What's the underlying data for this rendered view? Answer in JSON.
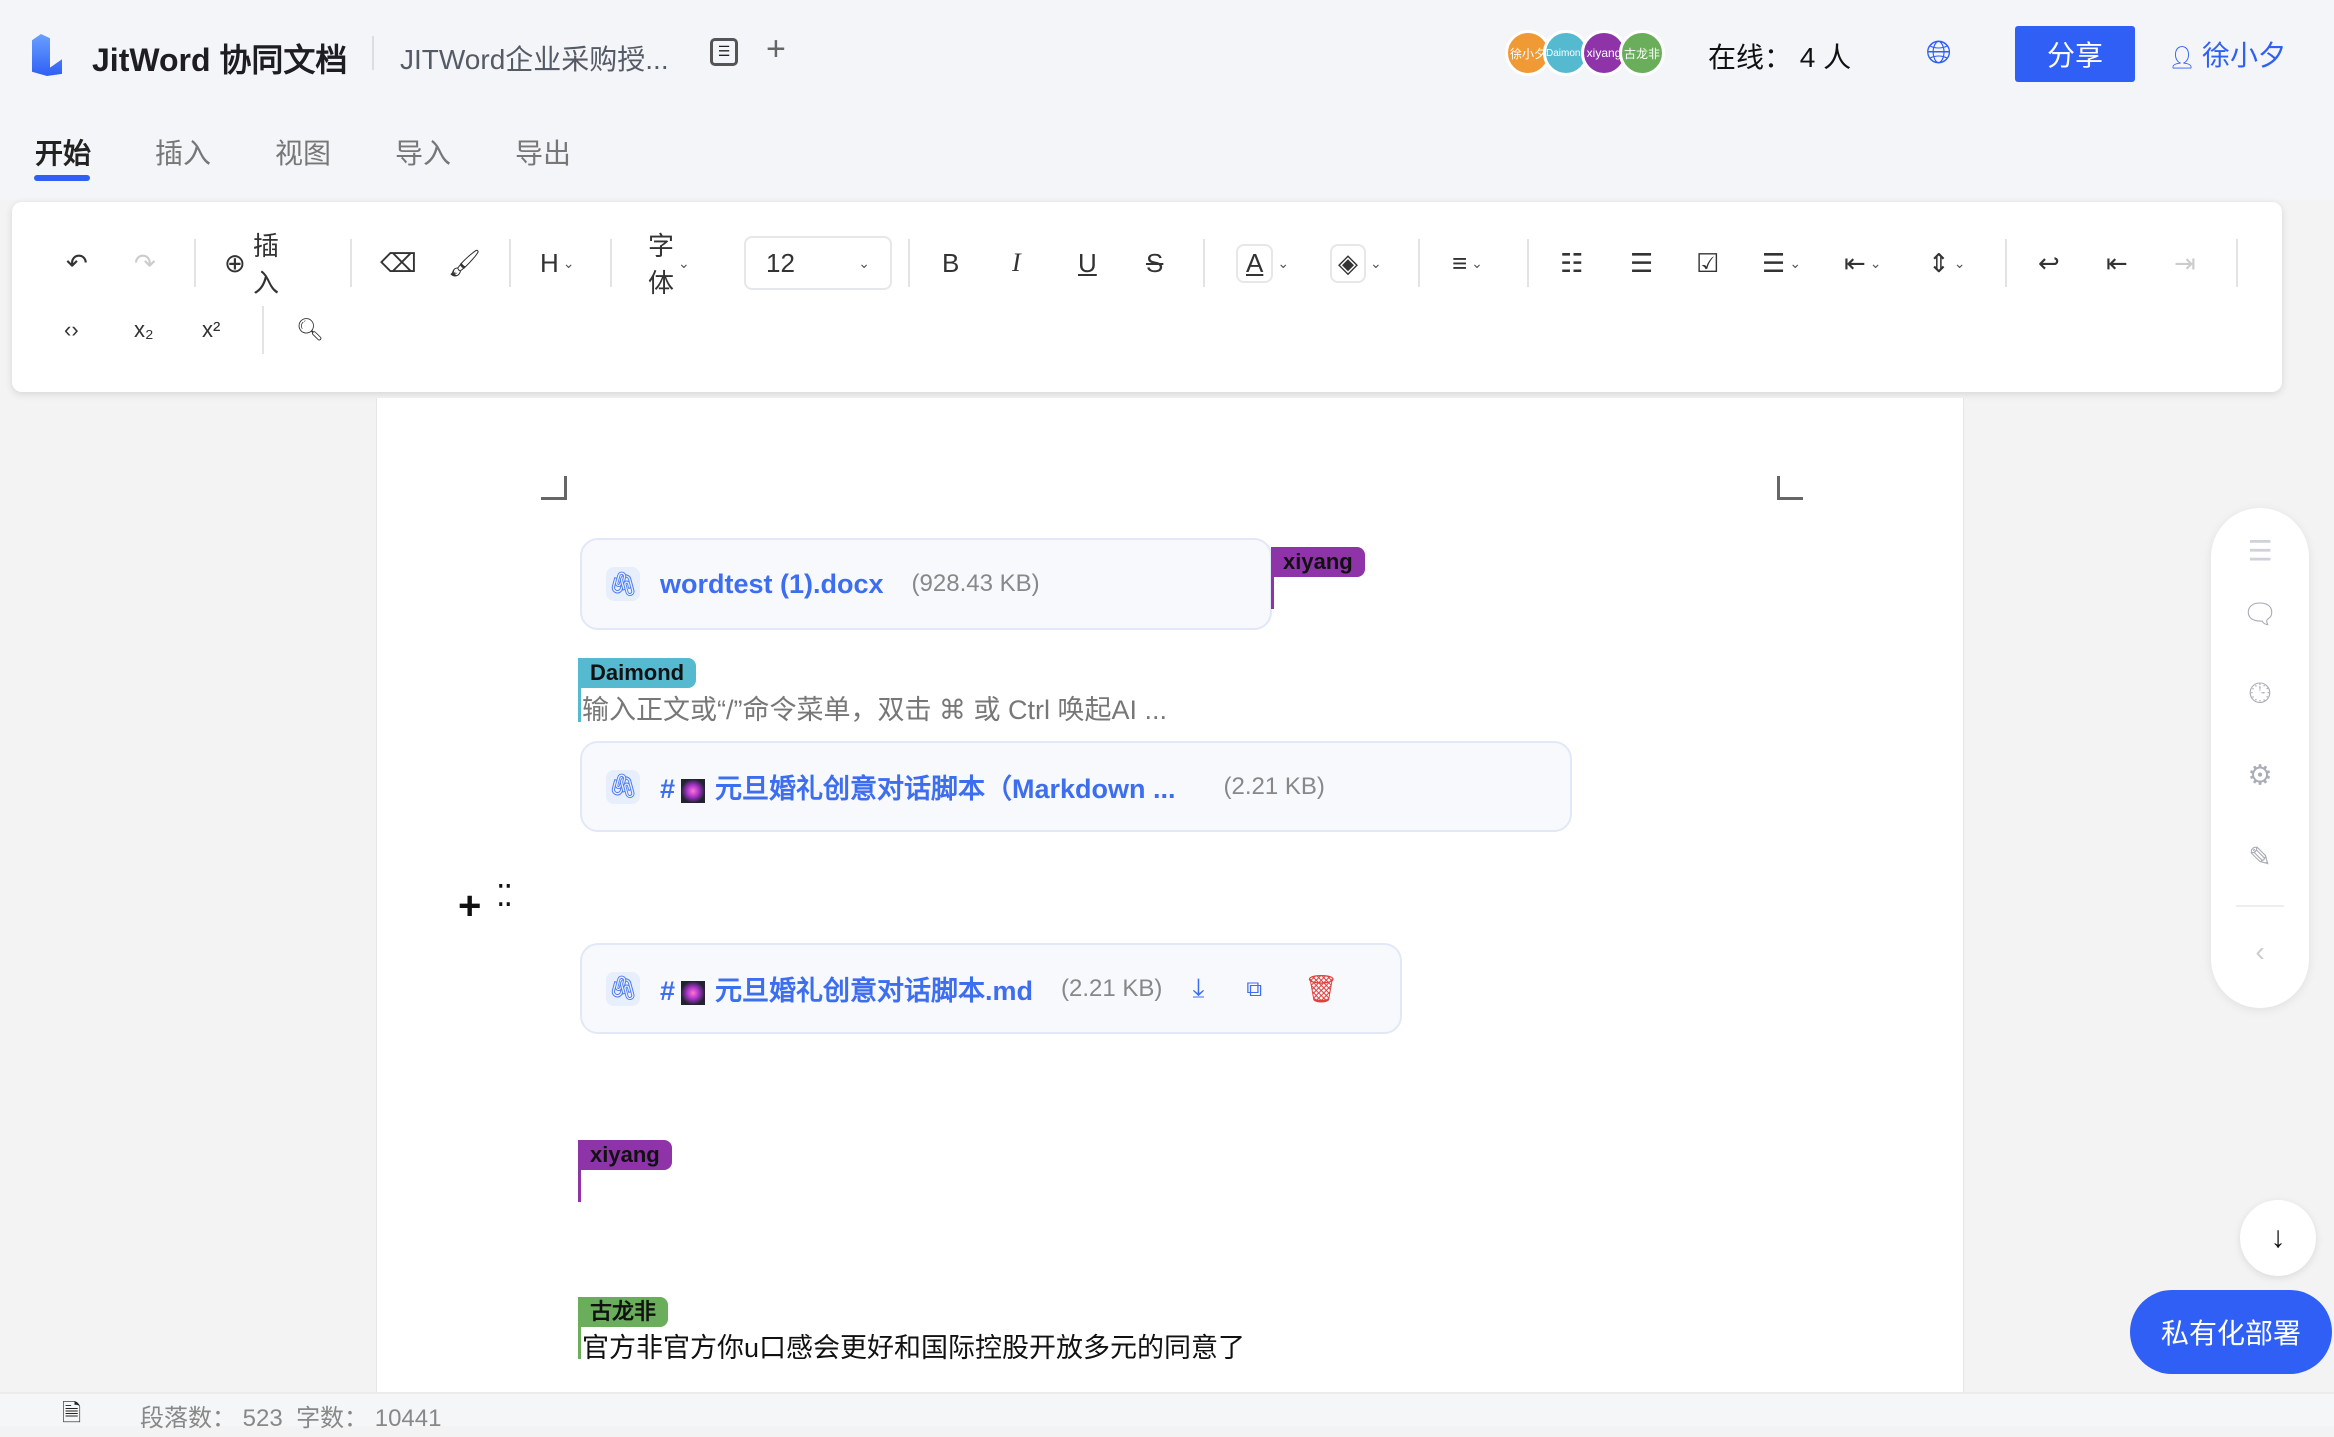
{
  "header": {
    "app_title": "JitWord 协同文档",
    "doc_title": "JITWord企业采购授...",
    "online_label": "在线：",
    "online_count": "4 人",
    "share_label": "分享",
    "user_name": "徐小夕",
    "avatars": [
      {
        "label": "徐小夕",
        "color": "#f09a35"
      },
      {
        "label": "Daimond",
        "color": "#55b9d0"
      },
      {
        "label": "xiyang",
        "color": "#8e33a8"
      },
      {
        "label": "古龙非",
        "color": "#6aad5b"
      }
    ]
  },
  "tabs": [
    "开始",
    "插入",
    "视图",
    "导入",
    "导出"
  ],
  "toolbar": {
    "insert_label": "插入",
    "heading_label": "H",
    "font_label": "字体",
    "font_size": "12",
    "subscript": "x₂",
    "superscript": "x²"
  },
  "doc": {
    "file1": {
      "name": "wordtest (1).docx",
      "size": "(928.43 KB)"
    },
    "file2": {
      "name": "元旦婚礼创意对话脚本（Markdown ...",
      "prefix": "#",
      "size": "(2.21 KB)"
    },
    "file3": {
      "name": "元旦婚礼创意对话脚本.md",
      "prefix": "#",
      "size": "(2.21 KB)"
    },
    "placeholder": "输入正文或“/”命令菜单，双击 ⌘ 或 Ctrl 唤起AI ...",
    "paragraph": "官方非官方你u口感会更好和国际控股开放多元的同意了",
    "cursors": [
      {
        "user": "xiyang",
        "color": "#8e33a8"
      },
      {
        "user": "Daimond",
        "color": "#55b9d0"
      },
      {
        "user": "xiyang",
        "color": "#8e33a8"
      },
      {
        "user": "古龙非",
        "color": "#6aad5b"
      }
    ]
  },
  "status": {
    "para_label": "段落数：",
    "para_count": "523",
    "word_label": "字数：",
    "word_count": "10441"
  },
  "deploy_label": "私有化部署",
  "colors": {
    "accent": "#2f5ff5",
    "danger": "#e0413a"
  }
}
